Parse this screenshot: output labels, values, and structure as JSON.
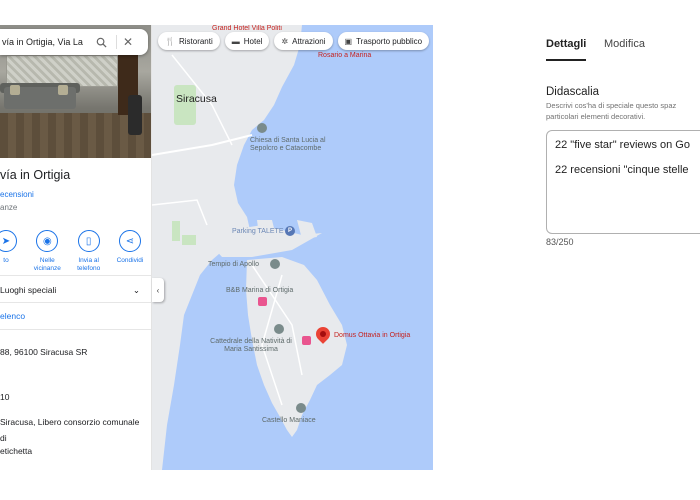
{
  "search": {
    "query": "vía in Ortigia, Via La"
  },
  "place": {
    "name": "vía in Ortigia",
    "reviews": "ecensioni",
    "subtype": "anze"
  },
  "actions": [
    {
      "label": "to"
    },
    {
      "label": "Nelle vicinanze"
    },
    {
      "label": "Invia al telefono"
    },
    {
      "label": "Condividi"
    }
  ],
  "details": {
    "special": "Luoghi speciali",
    "list": "elenco",
    "address": "88, 96100 Siracusa SR",
    "phone": "10",
    "region": "Siracusa, Libero consorzio comunale di",
    "label": "etichetta"
  },
  "map": {
    "chips": [
      {
        "label": "Ristoranti",
        "icon": "utensils-icon"
      },
      {
        "label": "Hotel",
        "icon": "bed-icon"
      },
      {
        "label": "Attrazioni",
        "icon": "attractions-icon"
      },
      {
        "label": "Trasporto pubblico",
        "icon": "bus-icon"
      }
    ],
    "labels": {
      "hotel_top": "Grand Hotel Villa Politi",
      "rosolino": "Rosario a Marina",
      "siracusa": "Siracusa",
      "church": "Chiesa di Santa Lucia al Sepolcro e Catacombe",
      "parking": "Parking TALETE",
      "apollo": "Tempio di Apollo",
      "bnb": "B&B Marina di Ortigia",
      "cathedral": "Cattedrale della Natività di Maria Santissima",
      "domus": "Domus Ottavia in Ortigia",
      "castle": "Castello Maniace"
    },
    "colors": {
      "water": "#aecbfa",
      "land": "#e8eaed",
      "park": "#c9e5c1",
      "pin": "#ea4335"
    }
  },
  "editor": {
    "tabs": [
      "Dettagli",
      "Modifica"
    ],
    "section_title": "Didascalia",
    "section_desc": "Descrivi cos'ha di speciale questo spaz particolari elementi decorativi.",
    "caption_lines": [
      "22 \"five star\" reviews on Go",
      "22 recensioni \"cinque stelle"
    ],
    "counter": "83/250"
  }
}
